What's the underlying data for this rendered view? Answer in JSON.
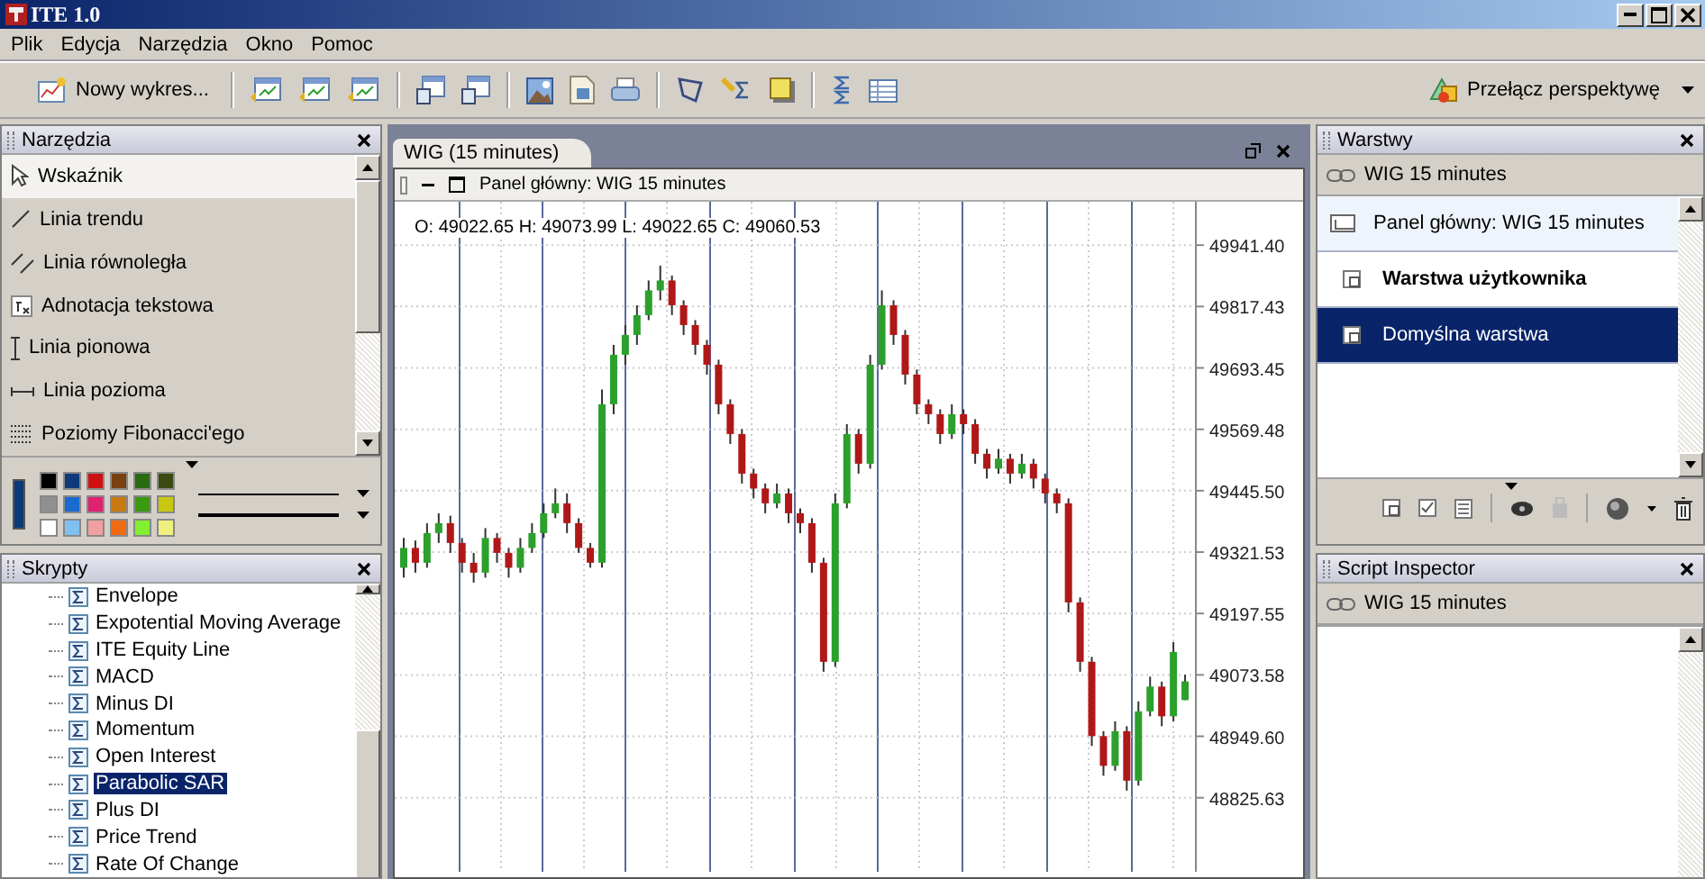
{
  "window": {
    "title": "ITE 1.0"
  },
  "menu": [
    "Plik",
    "Edycja",
    "Narzędzia",
    "Okno",
    "Pomoc"
  ],
  "toolbar": {
    "new_chart": "Nowy wykres...",
    "perspective": "Przełącz perspektywę"
  },
  "tools_panel": {
    "title": "Narzędzia",
    "items": [
      {
        "label": "Wskaźnik",
        "kind": "pointer",
        "selected": true
      },
      {
        "label": "Linia trendu",
        "kind": "trend",
        "selected": false
      },
      {
        "label": "Linia równoległa",
        "kind": "parallel",
        "selected": false
      },
      {
        "label": "Adnotacja tekstowa",
        "kind": "text",
        "selected": false
      },
      {
        "label": "Linia pionowa",
        "kind": "vertical",
        "selected": false
      },
      {
        "label": "Linia pozioma",
        "kind": "horizontal",
        "selected": false
      },
      {
        "label": "Poziomy Fibonacci'ego",
        "kind": "fibonacci",
        "selected": false
      }
    ],
    "current_color": {
      "color": "#0b3a78"
    },
    "palette": [
      {
        "color": "#000000"
      },
      {
        "color": "#0d3a7a"
      },
      {
        "color": "#d01010"
      },
      {
        "color": "#7a4010"
      },
      {
        "color": "#2a6a10"
      },
      {
        "color": "#3a4a10"
      },
      {
        "color": "#909090"
      },
      {
        "color": "#1a6ad0"
      },
      {
        "color": "#e02070"
      },
      {
        "color": "#c87a10"
      },
      {
        "color": "#3a9a10"
      },
      {
        "color": "#c8c810"
      },
      {
        "color": "#ffffff"
      },
      {
        "color": "#80c0f0"
      },
      {
        "color": "#f0a0a0"
      },
      {
        "color": "#f06a10"
      },
      {
        "color": "#80f030"
      },
      {
        "color": "#f0f080"
      }
    ]
  },
  "scripts_panel": {
    "title": "Skrypty",
    "items": [
      {
        "label": "Envelope",
        "selected": false
      },
      {
        "label": "Expotential Moving Average",
        "selected": false
      },
      {
        "label": "ITE Equity Line",
        "selected": false
      },
      {
        "label": "MACD",
        "selected": false
      },
      {
        "label": "Minus DI",
        "selected": false
      },
      {
        "label": "Momentum",
        "selected": false
      },
      {
        "label": "Open Interest",
        "selected": false
      },
      {
        "label": "Parabolic SAR",
        "selected": true
      },
      {
        "label": "Plus DI",
        "selected": false
      },
      {
        "label": "Price Trend",
        "selected": false
      },
      {
        "label": "Rate Of Change",
        "selected": false
      }
    ]
  },
  "chart_window": {
    "tab": "WIG (15 minutes)",
    "panel_title": "Panel główny: WIG 15 minutes",
    "ohlc": "O: 49022.65 H: 49073.99 L: 49022.65 C: 49060.53",
    "chart_data": {
      "type": "candlestick",
      "grid": true,
      "ylim": [
        48676,
        50029
      ],
      "yticks": [
        {
          "value": 49941.4,
          "label": "49941.40"
        },
        {
          "value": 49817.43,
          "label": "49817.43"
        },
        {
          "value": 49693.45,
          "label": "49693.45"
        },
        {
          "value": 49569.48,
          "label": "49569.48"
        },
        {
          "value": 49445.5,
          "label": "49445.50"
        },
        {
          "value": 49321.53,
          "label": "49321.53"
        },
        {
          "value": 49197.55,
          "label": "49197.55"
        },
        {
          "value": 49073.58,
          "label": "49073.58"
        },
        {
          "value": 48949.6,
          "label": "48949.60"
        },
        {
          "value": 48825.63,
          "label": "48825.63"
        }
      ],
      "ohlc": [
        [
          49290,
          49350,
          49270,
          49330
        ],
        [
          49330,
          49345,
          49280,
          49300
        ],
        [
          49300,
          49380,
          49290,
          49360
        ],
        [
          49360,
          49400,
          49340,
          49380
        ],
        [
          49380,
          49395,
          49320,
          49340
        ],
        [
          49340,
          49350,
          49280,
          49300
        ],
        [
          49300,
          49320,
          49260,
          49280
        ],
        [
          49280,
          49370,
          49270,
          49350
        ],
        [
          49350,
          49360,
          49300,
          49320
        ],
        [
          49320,
          49330,
          49270,
          49290
        ],
        [
          49290,
          49350,
          49280,
          49330
        ],
        [
          49330,
          49380,
          49320,
          49360
        ],
        [
          49360,
          49420,
          49350,
          49400
        ],
        [
          49400,
          49450,
          49390,
          49420
        ],
        [
          49420,
          49440,
          49360,
          49380
        ],
        [
          49380,
          49390,
          49320,
          49330
        ],
        [
          49330,
          49340,
          49290,
          49300
        ],
        [
          49300,
          49650,
          49290,
          49620
        ],
        [
          49620,
          49740,
          49600,
          49720
        ],
        [
          49720,
          49780,
          49700,
          49760
        ],
        [
          49760,
          49820,
          49740,
          49800
        ],
        [
          49800,
          49870,
          49790,
          49850
        ],
        [
          49850,
          49900,
          49830,
          49870
        ],
        [
          49870,
          49880,
          49800,
          49820
        ],
        [
          49820,
          49830,
          49760,
          49780
        ],
        [
          49780,
          49790,
          49720,
          49740
        ],
        [
          49740,
          49750,
          49680,
          49700
        ],
        [
          49700,
          49710,
          49600,
          49620
        ],
        [
          49620,
          49630,
          49540,
          49560
        ],
        [
          49560,
          49570,
          49460,
          49480
        ],
        [
          49480,
          49490,
          49430,
          49450
        ],
        [
          49450,
          49460,
          49400,
          49420
        ],
        [
          49420,
          49460,
          49410,
          49440
        ],
        [
          49440,
          49450,
          49380,
          49400
        ],
        [
          49400,
          49410,
          49360,
          49380
        ],
        [
          49380,
          49390,
          49280,
          49300
        ],
        [
          49300,
          49310,
          49080,
          49100
        ],
        [
          49100,
          49440,
          49090,
          49420
        ],
        [
          49420,
          49580,
          49410,
          49560
        ],
        [
          49560,
          49570,
          49480,
          49500
        ],
        [
          49500,
          49720,
          49490,
          49700
        ],
        [
          49700,
          49850,
          49690,
          49820
        ],
        [
          49820,
          49830,
          49740,
          49760
        ],
        [
          49760,
          49770,
          49660,
          49680
        ],
        [
          49680,
          49690,
          49600,
          49620
        ],
        [
          49620,
          49630,
          49580,
          49600
        ],
        [
          49600,
          49610,
          49540,
          49560
        ],
        [
          49560,
          49620,
          49550,
          49600
        ],
        [
          49600,
          49610,
          49560,
          49580
        ],
        [
          49580,
          49590,
          49500,
          49520
        ],
        [
          49520,
          49530,
          49470,
          49490
        ],
        [
          49490,
          49530,
          49480,
          49510
        ],
        [
          49510,
          49520,
          49460,
          49480
        ],
        [
          49480,
          49520,
          49470,
          49500
        ],
        [
          49500,
          49510,
          49450,
          49470
        ],
        [
          49470,
          49480,
          49420,
          49440
        ],
        [
          49440,
          49450,
          49400,
          49420
        ],
        [
          49420,
          49430,
          49200,
          49220
        ],
        [
          49220,
          49230,
          49080,
          49100
        ],
        [
          49100,
          49110,
          48930,
          48950
        ],
        [
          48950,
          48960,
          48870,
          48890
        ],
        [
          48890,
          48980,
          48880,
          48960
        ],
        [
          48960,
          48970,
          48840,
          48860
        ],
        [
          48860,
          49020,
          48850,
          49000
        ],
        [
          49000,
          49070,
          48990,
          49050
        ],
        [
          49050,
          49060,
          48970,
          48990
        ],
        [
          48990,
          49140,
          48980,
          49120
        ],
        [
          49022.65,
          49073.99,
          49022.65,
          49060.53
        ]
      ]
    }
  },
  "layers_panel": {
    "title": "Warstwy",
    "source": "WIG 15 minutes",
    "items": [
      {
        "label": "Panel główny: WIG 15 minutes",
        "kind": "panel",
        "selected": false
      },
      {
        "label": "Warstwa użytkownika",
        "kind": "user",
        "selected": false
      },
      {
        "label": "Domyślna warstwa",
        "kind": "layer",
        "selected": true
      }
    ]
  },
  "inspector": {
    "title": "Script Inspector",
    "source": "WIG 15 minutes"
  }
}
